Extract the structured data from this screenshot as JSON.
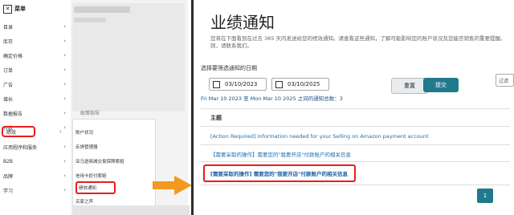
{
  "sidebar": {
    "menu_label": "菜单",
    "items": [
      {
        "label": "目录"
      },
      {
        "label": "库存"
      },
      {
        "label": "确定价格"
      },
      {
        "label": "订单"
      },
      {
        "label": "广告"
      },
      {
        "label": "增长"
      },
      {
        "label": "数据报告"
      },
      {
        "label": "付款"
      },
      {
        "label": "绩效"
      },
      {
        "label": "应用程序和服务"
      },
      {
        "label": "B2B"
      },
      {
        "label": "品牌"
      },
      {
        "label": "学习"
      }
    ]
  },
  "submenu": {
    "header": "政策指导",
    "items": [
      {
        "label": "账户状况"
      },
      {
        "label": "反馈管理器"
      },
      {
        "label": "亚马逊商城交易保障索赔"
      },
      {
        "label": "信用卡拒付索赔"
      },
      {
        "label": "绩效通知"
      },
      {
        "label": "买家之声"
      }
    ]
  },
  "main": {
    "title": "业绩通知",
    "description": "您将在下面看到在过去 365 天内发送给您的绩效通知。请查看这些通知，了解可能影响您的账户状况及您能否销售的重要提醒。",
    "description_cont": "则，请联系我们。",
    "contact_link": "联系我们",
    "date_label": "选择要筛选通知的日期",
    "date_from": "03/10/2023",
    "date_to": "03/10/2025",
    "reset_label": "重置",
    "submit_label": "提交",
    "filter_placeholder": "过滤",
    "range_text": "Fri Mar 10 2023 至 Mon Mar 10 2025 之间的通知总数：3",
    "column_header": "主题",
    "notifications": [
      {
        "subject": "[Action Required] Information needed for your Selling on Amazon payment account"
      },
      {
        "subject": "【需要采取的操作】需要您的\"我要开店\"付款账户的相关信息"
      },
      {
        "subject": "[需要采取的操作] 需要您的\"我要开店\"付款账户的相关信息"
      }
    ],
    "page_number": "1"
  },
  "colors": {
    "accent": "#1f7a8c",
    "highlight": "#e81d1d",
    "arrow": "#f39a1e"
  }
}
